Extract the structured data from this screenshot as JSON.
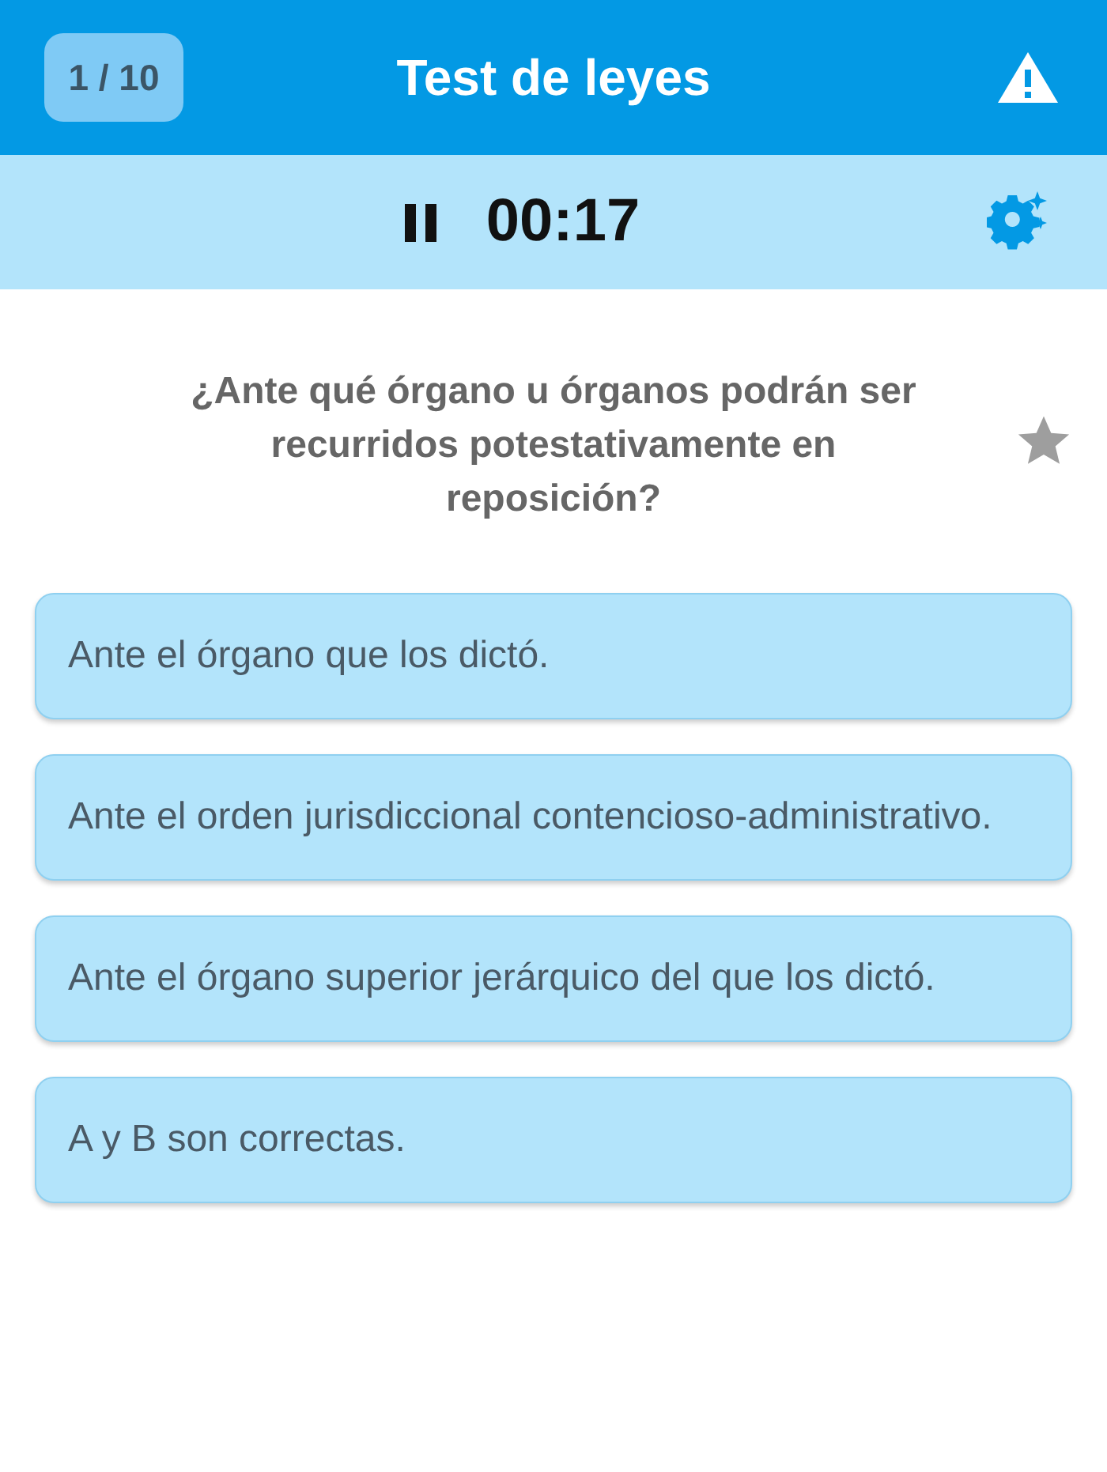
{
  "header": {
    "counter": "1 / 10",
    "title": "Test de leyes"
  },
  "timer": {
    "paused": false,
    "time": "00:17"
  },
  "question": {
    "text": "¿Ante qué órgano u órganos podrán ser recurridos potestativamente en reposición?",
    "favorite": false
  },
  "answers": [
    {
      "text": "Ante el órgano que los dictó.",
      "selected": false
    },
    {
      "text": "Ante el orden jurisdiccional contencioso-administrativo.",
      "selected": false
    },
    {
      "text": "Ante el órgano superior jerárquico del que los dictó.",
      "selected": false
    },
    {
      "text": "A y B son correctas.",
      "selected": false
    }
  ]
}
